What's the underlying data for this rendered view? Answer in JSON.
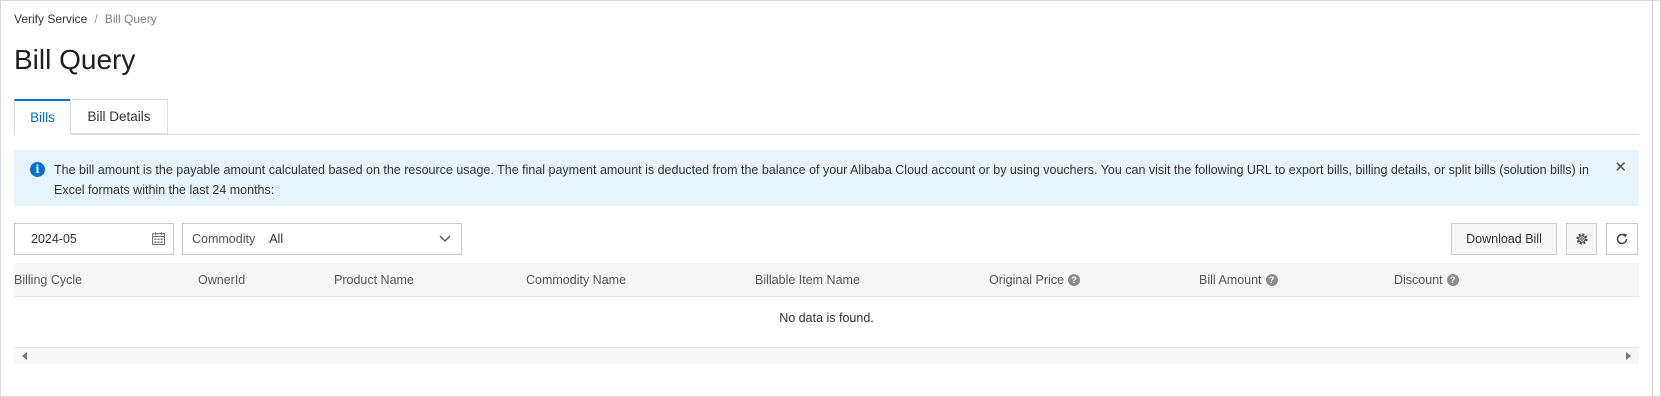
{
  "breadcrumb": {
    "parent": "Verify Service",
    "separator": "/",
    "current": "Bill Query"
  },
  "page": {
    "title": "Bill Query"
  },
  "tabs": [
    {
      "label": "Bills",
      "active": true
    },
    {
      "label": "Bill Details",
      "active": false
    }
  ],
  "notice": {
    "text": "The bill amount is the payable amount calculated based on the resource usage. The final payment amount is deducted from the balance of your Alibaba Cloud account or by using vouchers. You can visit the following URL to export bills, billing details, or split bills (solution bills) in Excel formats within the last 24 months:",
    "info_glyph": "i",
    "close_glyph": "✕",
    "icon": "info-icon",
    "background_color": "#e8f4fd",
    "accent_color": "#0070cc"
  },
  "filters": {
    "billing_cycle_value": "2024-05",
    "commodity_label": "Commodity",
    "commodity_value": "All"
  },
  "toolbar": {
    "download_label": "Download Bill",
    "settings_icon": "gear-icon",
    "refresh_icon": "refresh-icon"
  },
  "table": {
    "columns": [
      "Billing Cycle",
      "OwnerId",
      "Product Name",
      "Commodity Name",
      "Billable Item Name",
      "Original Price",
      "Bill Amount",
      "Discount"
    ],
    "help_glyph": "?",
    "empty_text": "No data is found."
  }
}
